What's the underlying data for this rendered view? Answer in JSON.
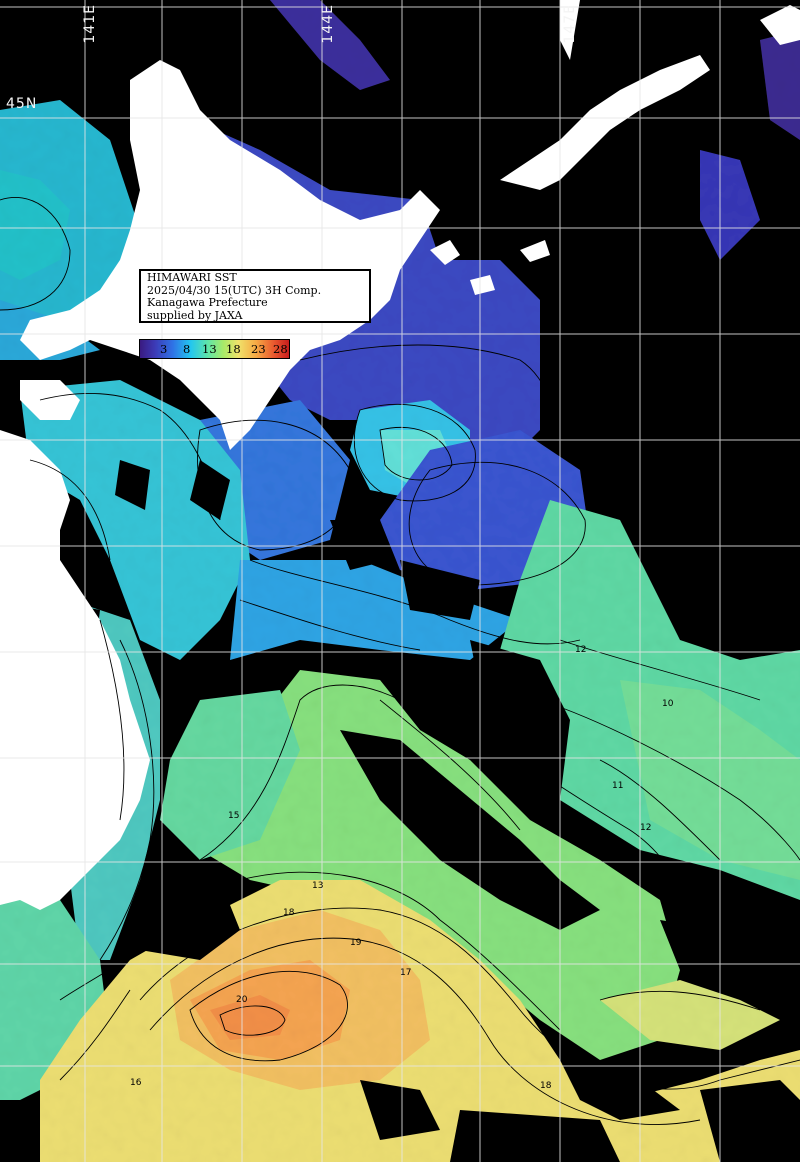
{
  "info": {
    "line1": "HIMAWARI SST",
    "line2": "2025/04/30 15(UTC) 3H Comp.",
    "line3": "Kanagawa Prefecture",
    "line4": "supplied by JAXA"
  },
  "legend": {
    "ticks": [
      "3",
      "8",
      "13",
      "18",
      "23",
      "28"
    ],
    "colors": [
      "#3a1a80",
      "#3c3ab6",
      "#2f73e6",
      "#23c6ef",
      "#62e6a6",
      "#a8ea68",
      "#f0e26a",
      "#f6a944",
      "#e9572e",
      "#c81d1d"
    ]
  },
  "grid_labels": {
    "lon": [
      "141E",
      "144E",
      "147E"
    ],
    "lat": [
      "45N"
    ]
  },
  "contour_labels": [
    "10",
    "11",
    "12",
    "13",
    "15",
    "16",
    "17",
    "18",
    "19",
    "20"
  ]
}
